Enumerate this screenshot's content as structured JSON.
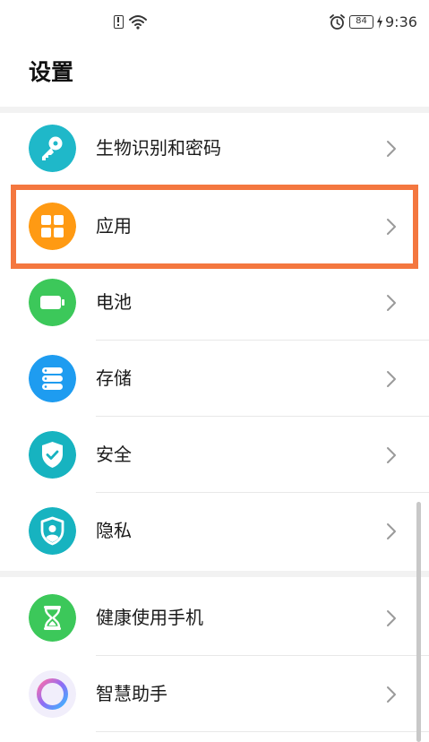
{
  "status_bar": {
    "battery_level": "84",
    "time": "9:36"
  },
  "page": {
    "title": "设置"
  },
  "items": [
    {
      "label": "生物识别和密码",
      "icon": "key-icon",
      "color": "#1fb8c9"
    },
    {
      "label": "应用",
      "icon": "apps-grid-icon",
      "color": "#ff9a13",
      "highlighted": true
    },
    {
      "label": "电池",
      "icon": "battery-icon",
      "color": "#3cc85a"
    },
    {
      "label": "存储",
      "icon": "storage-icon",
      "color": "#1e9cf0"
    },
    {
      "label": "安全",
      "icon": "shield-check-icon",
      "color": "#17b3c0"
    },
    {
      "label": "隐私",
      "icon": "privacy-shield-icon",
      "color": "#17b3c0"
    },
    {
      "label": "健康使用手机",
      "icon": "hourglass-icon",
      "color": "#3cc85a"
    },
    {
      "label": "智慧助手",
      "icon": "assistant-ring-icon",
      "color": "#8e6cf5"
    }
  ],
  "colors": {
    "highlight_border": "#f4773f",
    "chevron": "#9a9a9a"
  }
}
